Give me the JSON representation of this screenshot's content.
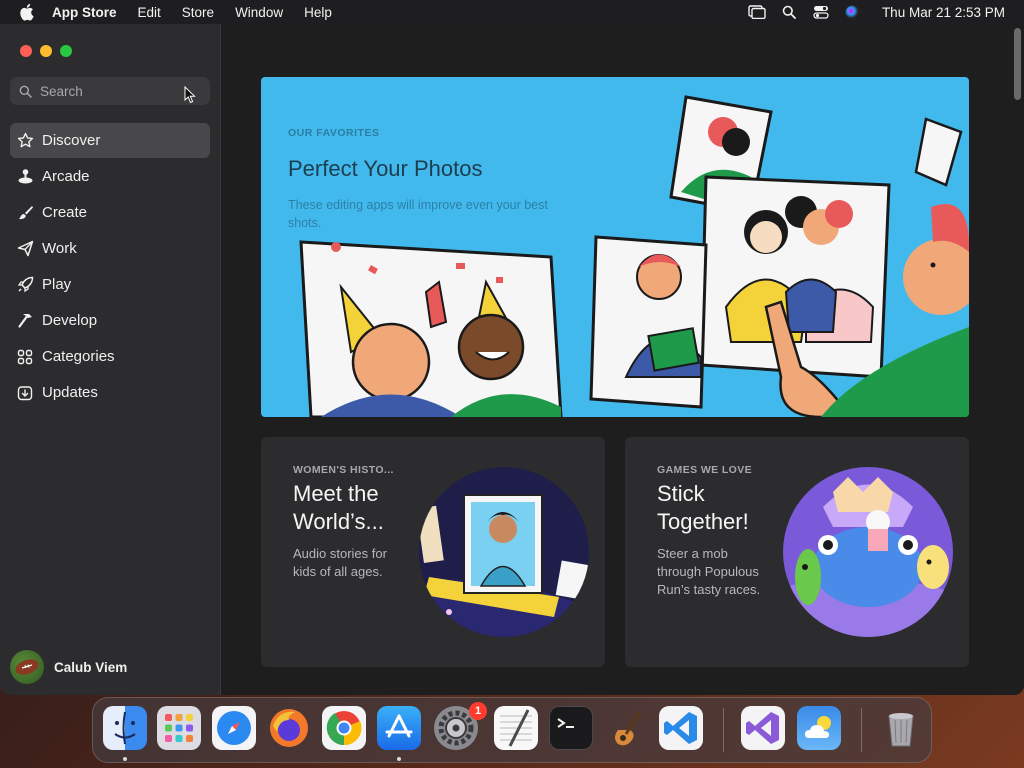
{
  "menubar": {
    "app_name": "App Store",
    "items": [
      "Edit",
      "Store",
      "Window",
      "Help"
    ],
    "clock": "Thu Mar 21  2:53 PM"
  },
  "sidebar": {
    "search_placeholder": "Search",
    "items": [
      {
        "label": "Discover",
        "icon": "star-icon",
        "active": true
      },
      {
        "label": "Arcade",
        "icon": "joystick-icon"
      },
      {
        "label": "Create",
        "icon": "brush-icon"
      },
      {
        "label": "Work",
        "icon": "paper-plane-icon"
      },
      {
        "label": "Play",
        "icon": "rocket-icon"
      },
      {
        "label": "Develop",
        "icon": "hammer-icon"
      },
      {
        "label": "Categories",
        "icon": "grid-icon"
      },
      {
        "label": "Updates",
        "icon": "download-icon"
      }
    ],
    "user_name": "Calub Viem"
  },
  "hero": {
    "eyebrow": "OUR FAVORITES",
    "title": "Perfect Your Photos",
    "subtitle": "These editing apps will improve even your best shots."
  },
  "cards": [
    {
      "eyebrow": "WOMEN'S HISTO...",
      "title": "Meet the World’s...",
      "subtitle": "Audio stories for kids of all ages."
    },
    {
      "eyebrow": "GAMES WE LOVE",
      "title": "Stick Together!",
      "subtitle": "Steer a mob through Populous Run’s tasty races."
    }
  ],
  "dock": {
    "settings_badge": "1",
    "apps": [
      "finder-icon",
      "launchpad-icon",
      "safari-icon",
      "firefox-icon",
      "chrome-icon",
      "app-store-icon",
      "system-settings-icon",
      "textedit-icon",
      "terminal-icon",
      "garageband-icon",
      "vscode-icon",
      "visual-studio-icon",
      "weather-icon",
      "trash-icon"
    ]
  },
  "colors": {
    "accent": "#42b9ec",
    "sidebar_bg": "#2c2c2e",
    "main_bg": "#1e1e1e"
  }
}
